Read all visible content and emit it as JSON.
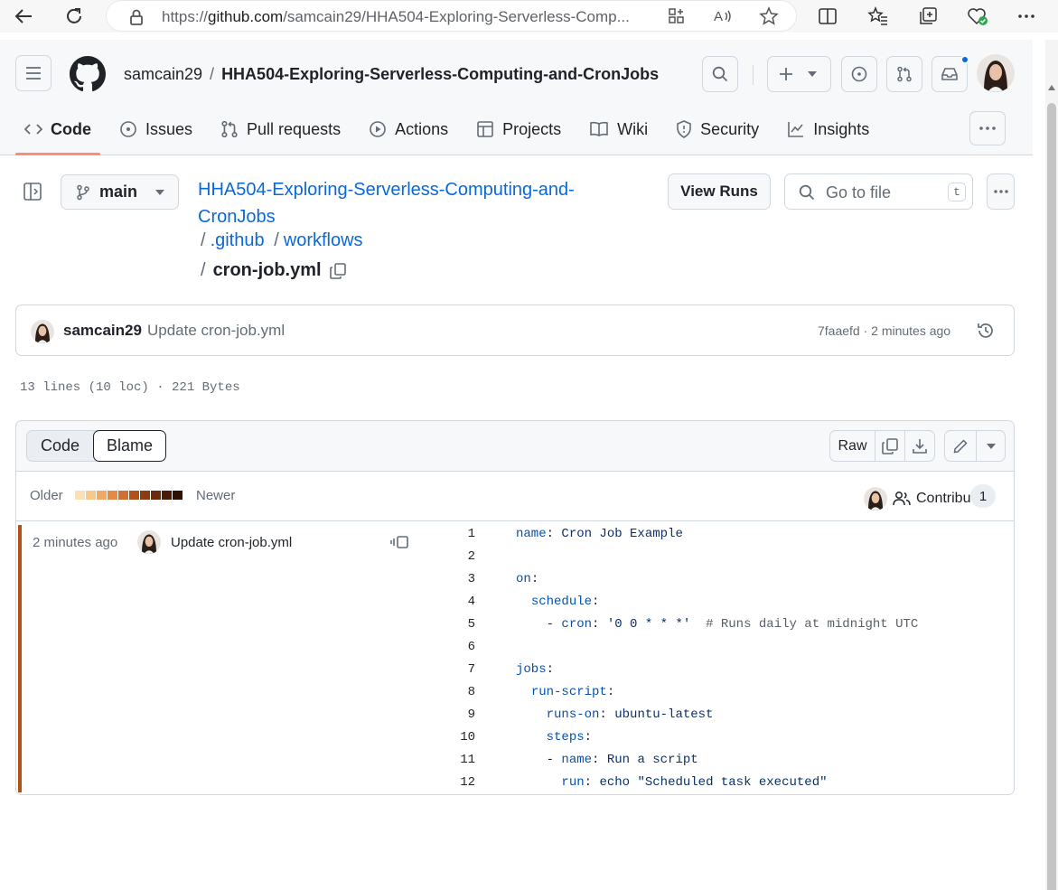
{
  "browser": {
    "url_prefix": "https://",
    "url_host": "github.com",
    "url_path": "/samcain29/HHA504-Exploring-Serverless-Comp..."
  },
  "header": {
    "owner": "samcain29",
    "separator": "/",
    "repo": "HHA504-Exploring-Serverless-Computing-and-CronJobs"
  },
  "tabs": [
    {
      "label": "Code",
      "icon": "code-icon",
      "active": true
    },
    {
      "label": "Issues",
      "icon": "issue-icon"
    },
    {
      "label": "Pull requests",
      "icon": "pull-request-icon"
    },
    {
      "label": "Actions",
      "icon": "play-icon"
    },
    {
      "label": "Projects",
      "icon": "table-icon"
    },
    {
      "label": "Wiki",
      "icon": "book-icon"
    },
    {
      "label": "Security",
      "icon": "shield-icon"
    },
    {
      "label": "Insights",
      "icon": "graph-icon"
    }
  ],
  "file_nav": {
    "branch": "main",
    "repo_link_line1": "HHA504-Exploring-Serverless-Computing-and-",
    "repo_link_line2": "CronJobs",
    "sep": "/",
    "dir1": ".github",
    "dir2": "workflows",
    "file": "cron-job.yml",
    "view_runs": "View Runs",
    "go_to_file_placeholder": "Go to file",
    "go_to_file_key": "t"
  },
  "commit": {
    "author": "samcain29",
    "message": "Update cron-job.yml",
    "meta": "7faaefd · 2 minutes ago"
  },
  "file_stats": "13 lines (10 loc) · 221 Bytes",
  "blame_toolbar": {
    "code": "Code",
    "blame": "Blame",
    "raw": "Raw"
  },
  "legend": {
    "older": "Older",
    "newer": "Newer",
    "colors": [
      "#fbe0b4",
      "#f6c88d",
      "#f0a865",
      "#e58a45",
      "#d07030",
      "#b15318",
      "#8c3b12",
      "#6b2a0d",
      "#4a1c08",
      "#2e1104"
    ],
    "contributors": "Contributors",
    "contributors_count": "1"
  },
  "blame": {
    "date": "2 minutes ago",
    "message": "Update cron-job.yml",
    "bar_color": "#b15318"
  },
  "code_lines": [
    {
      "n": "1",
      "parts": [
        [
          "k",
          "name"
        ],
        [
          "",
          ": "
        ],
        [
          "v",
          "Cron Job Example"
        ]
      ]
    },
    {
      "n": "2",
      "parts": []
    },
    {
      "n": "3",
      "parts": [
        [
          "k",
          "on"
        ],
        [
          "",
          ":"
        ]
      ]
    },
    {
      "n": "4",
      "parts": [
        [
          "",
          "  "
        ],
        [
          "k",
          "schedule"
        ],
        [
          "",
          ":"
        ]
      ]
    },
    {
      "n": "5",
      "parts": [
        [
          "",
          "    - "
        ],
        [
          "k",
          "cron"
        ],
        [
          "",
          ": "
        ],
        [
          "v",
          "'0 0 * * *'"
        ],
        [
          "",
          "  "
        ],
        [
          "c",
          "# Runs daily at midnight UTC"
        ]
      ]
    },
    {
      "n": "6",
      "parts": []
    },
    {
      "n": "7",
      "parts": [
        [
          "k",
          "jobs"
        ],
        [
          "",
          ":"
        ]
      ]
    },
    {
      "n": "8",
      "parts": [
        [
          "",
          "  "
        ],
        [
          "k",
          "run-script"
        ],
        [
          "",
          ":"
        ]
      ]
    },
    {
      "n": "9",
      "parts": [
        [
          "",
          "    "
        ],
        [
          "k",
          "runs-on"
        ],
        [
          "",
          ": "
        ],
        [
          "v",
          "ubuntu-latest"
        ]
      ]
    },
    {
      "n": "10",
      "parts": [
        [
          "",
          "    "
        ],
        [
          "k",
          "steps"
        ],
        [
          "",
          ":"
        ]
      ]
    },
    {
      "n": "11",
      "parts": [
        [
          "",
          "    - "
        ],
        [
          "k",
          "name"
        ],
        [
          "",
          ": "
        ],
        [
          "v",
          "Run a script"
        ]
      ]
    },
    {
      "n": "12",
      "parts": [
        [
          "",
          "      "
        ],
        [
          "k",
          "run"
        ],
        [
          "",
          ": "
        ],
        [
          "v",
          "echo \"Scheduled task executed\""
        ]
      ]
    }
  ]
}
